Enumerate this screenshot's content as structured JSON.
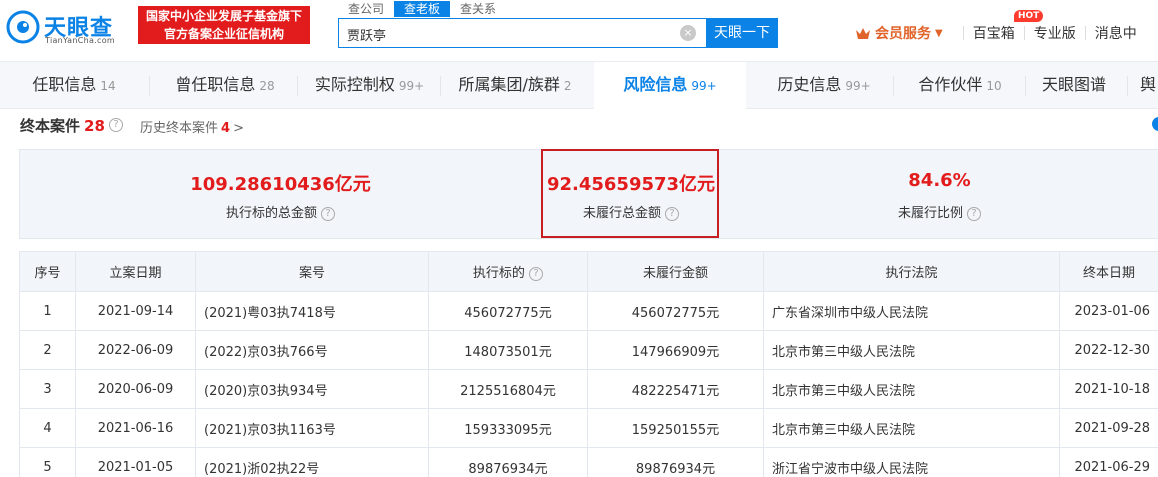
{
  "header": {
    "logo_text": "天眼查",
    "logo_sub": "TianYanCha.com",
    "gov_badge_line1": "国家中小企业发展子基金旗下",
    "gov_badge_line2": "官方备案企业征信机构",
    "search_tabs": [
      "查公司",
      "查老板",
      "查关系"
    ],
    "search_value": "贾跃亭",
    "search_button": "天眼一下",
    "vip_label": "会员服务",
    "nav": [
      "百宝箱",
      "专业版",
      "消息中"
    ],
    "hot_badge": "HOT"
  },
  "tabs": [
    {
      "label": "任职信息",
      "count": "14"
    },
    {
      "label": "曾任职信息",
      "count": "28"
    },
    {
      "label": "实际控制权",
      "count": "99+"
    },
    {
      "label": "所属集团/族群",
      "count": "2"
    },
    {
      "label": "风险信息",
      "count": "99+"
    },
    {
      "label": "历史信息",
      "count": "99+"
    },
    {
      "label": "合作伙伴",
      "count": "10"
    },
    {
      "label": "天眼图谱",
      "count": ""
    },
    {
      "label": "舆",
      "count": ""
    }
  ],
  "section": {
    "title": "终本案件",
    "count": "28",
    "history_label": "历史终本案件",
    "history_count": "4"
  },
  "stats": [
    {
      "value": "109.28610436亿元",
      "label": "执行标的总金额"
    },
    {
      "value": "92.45659573亿元",
      "label": "未履行总金额"
    },
    {
      "value": "84.6%",
      "label": "未履行比例"
    }
  ],
  "table": {
    "headers": [
      "序号",
      "立案日期",
      "案号",
      "执行标的",
      "未履行金额",
      "执行法院",
      "终本日期"
    ],
    "rows": [
      [
        "1",
        "2021-09-14",
        "(2021)粤03执7418号",
        "456072775元",
        "456072775元",
        "广东省深圳市中级人民法院",
        "2023-01-06"
      ],
      [
        "2",
        "2022-06-09",
        "(2022)京03执766号",
        "148073501元",
        "147966909元",
        "北京市第三中级人民法院",
        "2022-12-30"
      ],
      [
        "3",
        "2020-06-09",
        "(2020)京03执934号",
        "2125516804元",
        "482225471元",
        "北京市第三中级人民法院",
        "2021-10-18"
      ],
      [
        "4",
        "2021-06-16",
        "(2021)京03执1163号",
        "159333095元",
        "159250155元",
        "北京市第三中级人民法院",
        "2021-09-28"
      ],
      [
        "5",
        "2021-01-05",
        "(2021)浙02执22号",
        "89876934元",
        "89876934元",
        "浙江省宁波市中级人民法院",
        "2021-06-29"
      ]
    ]
  },
  "colors": {
    "brand": "#0a82e6",
    "alert": "#e21c1c",
    "vip": "#e0632a"
  }
}
